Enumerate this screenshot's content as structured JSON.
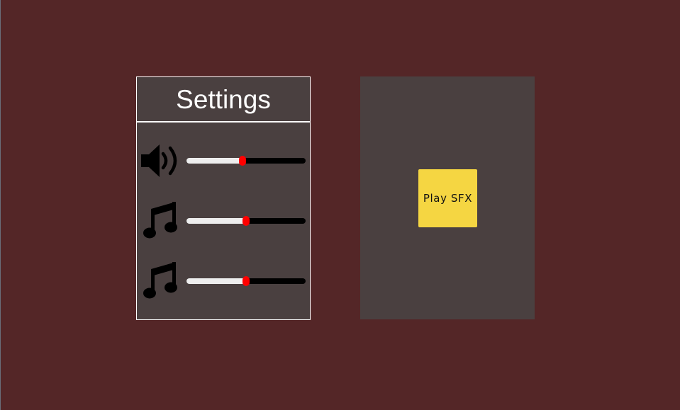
{
  "settings": {
    "title": "Settings",
    "rows": [
      {
        "icon": "speaker-icon",
        "value": 0.47
      },
      {
        "icon": "music-note-icon",
        "value": 0.5
      },
      {
        "icon": "music-note-icon",
        "value": 0.5
      }
    ]
  },
  "sfx": {
    "button_label": "Play SFX"
  },
  "colors": {
    "background": "#542627",
    "panel": "#4a4040",
    "button": "#f5d642",
    "slider_fill": "#eeeeee",
    "slider_track": "#000000",
    "slider_handle": "#ff0000"
  }
}
